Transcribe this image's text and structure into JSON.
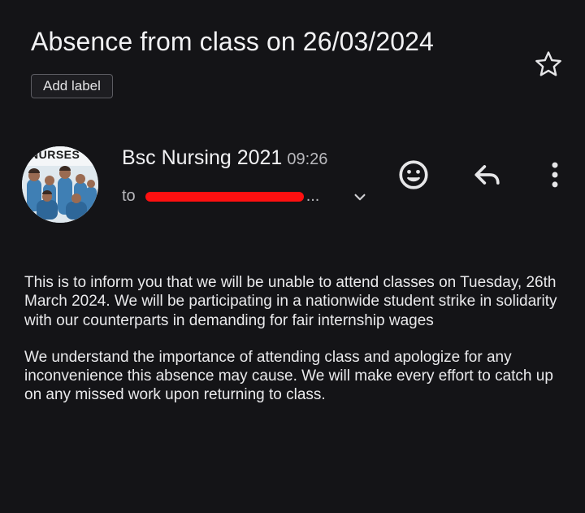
{
  "email": {
    "subject": "Absence from class on 26/03/2024",
    "add_label": "Add label",
    "avatar_text": "NURSES",
    "sender": "Bsc Nursing 2021",
    "time": "09:26",
    "to_prefix": "to",
    "to_suffix": "...",
    "body": [
      "This is to inform you that we will be unable to attend classes on Tuesday, 26th March 2024. We will be participating in a nationwide student strike in solidarity with our counterparts in demanding for fair internship wages",
      "We understand the importance of attending class and apologize for any inconvenience this absence may cause. We will make every effort to catch up on any missed work upon returning to class."
    ]
  },
  "icons": {
    "star": "star-icon",
    "expand": "chevron-down-icon",
    "emoji": "emoji-react-icon",
    "reply": "reply-icon",
    "more": "more-vert-icon"
  },
  "colors": {
    "background": "#141417",
    "text": "#eaeaec",
    "secondary_text": "#b9b9bd",
    "redaction": "#ff1010"
  }
}
